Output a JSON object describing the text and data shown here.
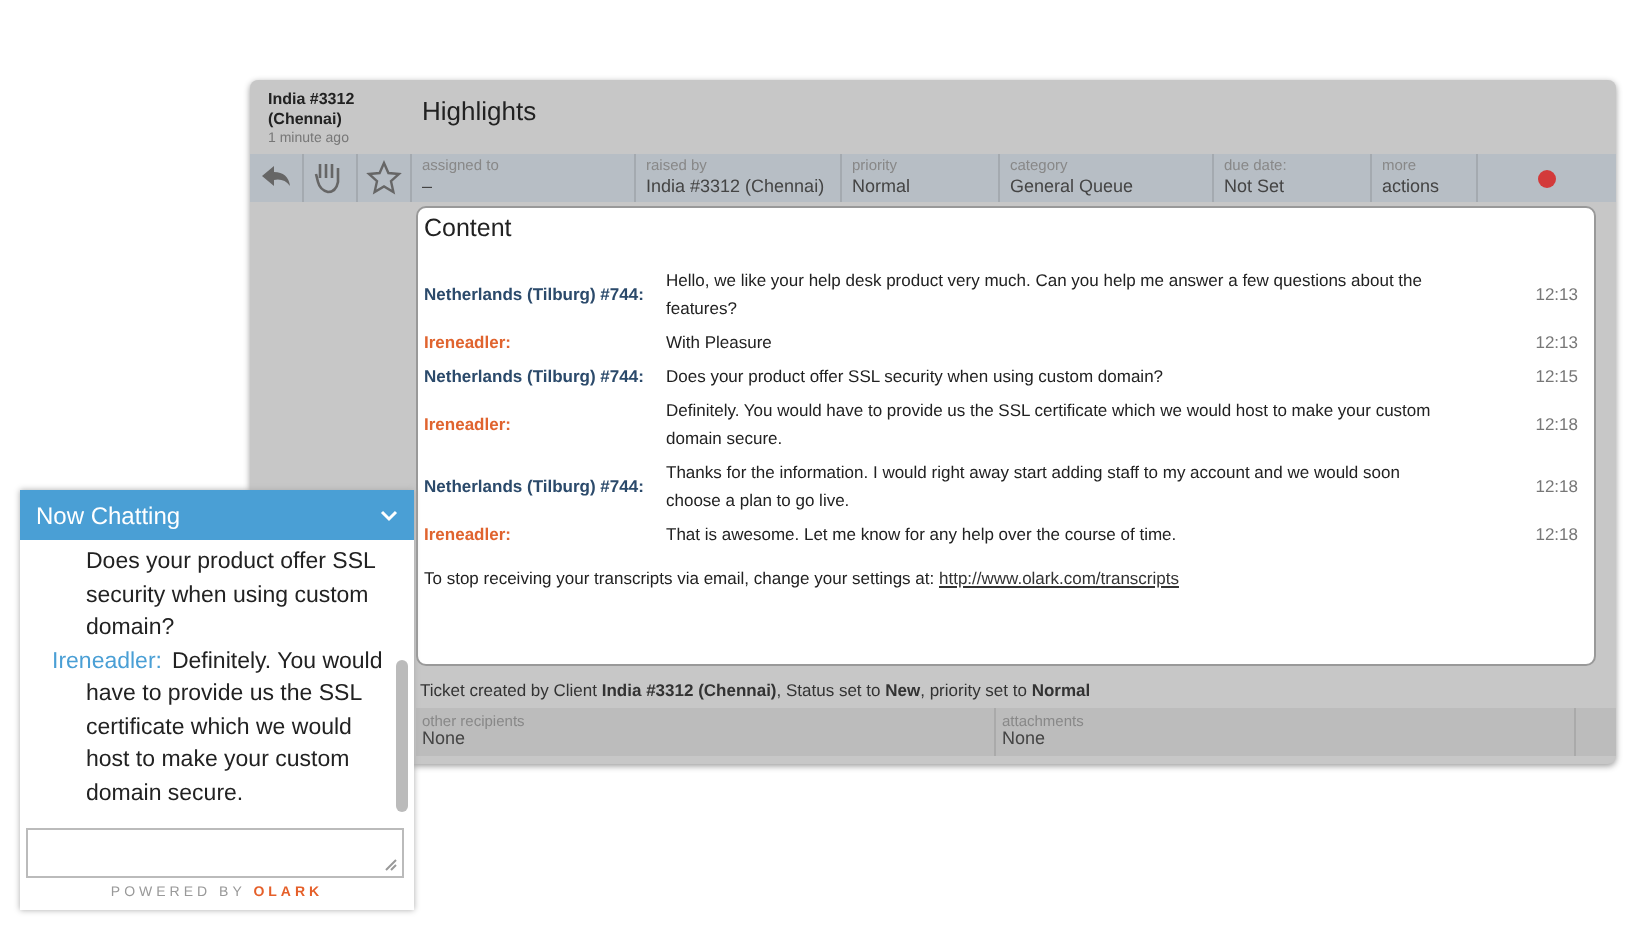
{
  "ticket": {
    "requester": "India #3312 (Chennai)",
    "age": "1 minute ago",
    "title": "Highlights",
    "toolbar_fields": [
      {
        "label": "assigned to",
        "value": "–"
      },
      {
        "label": "raised by",
        "value": "India #3312 (Chennai)"
      },
      {
        "label": "priority",
        "value": "Normal"
      },
      {
        "label": "category",
        "value": "General Queue"
      },
      {
        "label": "due date:",
        "value": "Not Set"
      },
      {
        "label": "more",
        "value": "actions"
      }
    ],
    "content": {
      "heading": "Content",
      "messages": [
        {
          "sender": "Netherlands (Tilburg) #744:",
          "kind": "visitor",
          "text": "Hello, we like your help desk product very much. Can you help me answer a few questions about the features?",
          "time": "12:13"
        },
        {
          "sender": "Ireneadler:",
          "kind": "operator",
          "text": "With Pleasure",
          "time": "12:13"
        },
        {
          "sender": "Netherlands (Tilburg) #744:",
          "kind": "visitor",
          "text": "Does your product offer SSL security when using custom domain?",
          "time": "12:15"
        },
        {
          "sender": "Ireneadler:",
          "kind": "operator",
          "text": "Definitely. You would have to provide us the SSL certificate which we would host to make your custom domain secure.",
          "time": "12:18"
        },
        {
          "sender": "Netherlands (Tilburg) #744:",
          "kind": "visitor",
          "text": "Thanks for the information. I would right away start adding staff to my account and we would soon choose a plan to go live.",
          "time": "12:18"
        },
        {
          "sender": "Ireneadler:",
          "kind": "operator",
          "text": "That is awesome. Let me know for any help over the course of time.",
          "time": "12:18"
        }
      ],
      "footer_text": "To stop receiving your transcripts via email, change your settings at:",
      "footer_link": "http://www.olark.com/transcripts"
    },
    "log": "Ticket created by Client **India #3312 (Chennai)**, Status set to **New**, priority set to **Normal**",
    "details": [
      {
        "label": "other recipients",
        "value": "None"
      },
      {
        "label": "attachments",
        "value": "None"
      }
    ]
  },
  "chat_widget": {
    "title": "Now Chatting",
    "messages": [
      {
        "text": "Does your product offer SSL security when using custom domain?"
      },
      {
        "sender": "Ireneadler:",
        "text": "Definitely. You would have to provide us the SSL certificate which we would host to make your custom domain secure."
      }
    ],
    "powered_by": "POWERED BY",
    "brand": "OLARK"
  }
}
